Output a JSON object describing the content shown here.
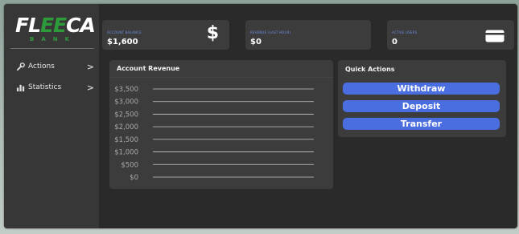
{
  "brand": {
    "name_white_1": "FL",
    "name_green": "EE",
    "name_white_2": "CA",
    "subtitle": "BANK"
  },
  "sidebar": {
    "items": [
      {
        "label": "Actions",
        "icon": "wrench-icon"
      },
      {
        "label": "Statistics",
        "icon": "bar-chart-icon"
      }
    ],
    "chevron": ">"
  },
  "stats": [
    {
      "label": "ACCOUNT BALANCE",
      "value": "$1,600",
      "icon": "dollar-icon"
    },
    {
      "label": "REVENUE (LAST HOUR)",
      "value": "$0"
    },
    {
      "label": "ACTIVE USERS",
      "value": "0",
      "icon": "credit-card-icon"
    }
  ],
  "revenue_panel": {
    "title": "Account Revenue"
  },
  "quick_actions": {
    "title": "Quick Actions",
    "buttons": [
      "Withdraw",
      "Deposit",
      "Transfer"
    ]
  },
  "colors": {
    "accent": "#4a6ee0",
    "brand_green": "#2e9b3a",
    "label_blue": "#6c8fe0"
  },
  "chart_data": {
    "type": "line",
    "title": "Account Revenue",
    "y_tick_labels": [
      "$3,500",
      "$3,000",
      "$2,500",
      "$2,000",
      "$1,500",
      "$1,000",
      "$500",
      "$0"
    ],
    "ylim": [
      0,
      3500
    ],
    "series": [],
    "grid": true
  }
}
